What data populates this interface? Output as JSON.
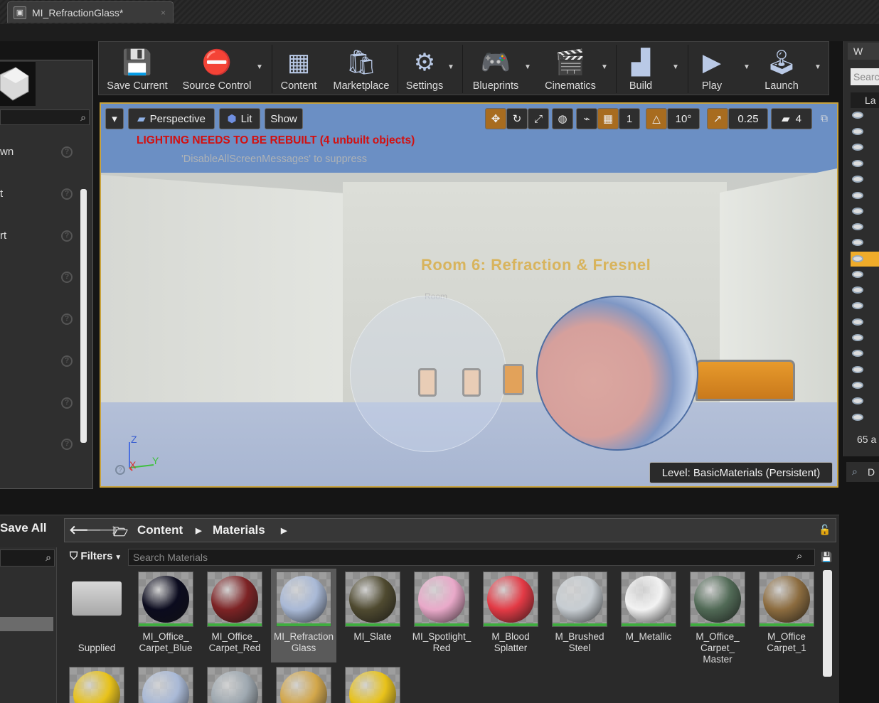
{
  "window": {
    "tab_title": "MI_RefractionGlass*",
    "close_glyph": "×"
  },
  "toolbar": {
    "save_current": "Save Current",
    "source_control": "Source Control",
    "content": "Content",
    "marketplace": "Marketplace",
    "settings": "Settings",
    "blueprints": "Blueprints",
    "cinematics": "Cinematics",
    "build": "Build",
    "play": "Play",
    "launch": "Launch"
  },
  "left_panel": {
    "items": [
      "wn",
      "t",
      "rt"
    ]
  },
  "viewport": {
    "perspective": "Perspective",
    "lit": "Lit",
    "show": "Show",
    "grid_value": "1",
    "rotation_snap": "10°",
    "scale_snap": "0.25",
    "camera_speed": "4",
    "lighting_warning": "LIGHTING NEEDS TO BE REBUILT (4 unbuilt objects)",
    "disable_message": "'DisableAllScreenMessages' to suppress",
    "room_label": "Room 6: Refraction & Fresnel",
    "room_small": "Room",
    "level": "Level:  BasicMaterials (Persistent)",
    "axis_z": "Z",
    "axis_x": "X",
    "axis_y": "Y"
  },
  "right_panel": {
    "header": "W",
    "search": "Searc",
    "column": "La",
    "count": "65 a",
    "details_tab": "D"
  },
  "content_browser": {
    "save_all": "Save All",
    "path": [
      "Content",
      "Materials"
    ],
    "filters": "Filters",
    "search_placeholder": "Search Materials",
    "assets": [
      {
        "name": "Supplied",
        "color": "#b5b5b5"
      },
      {
        "name": "MI_Office_ Carpet_Blue",
        "color": "#0b0b1e"
      },
      {
        "name": "MI_Office_ Carpet_Red",
        "color": "#7d2325"
      },
      {
        "name": "MI_Refraction Glass",
        "color": "#a9b9d6"
      },
      {
        "name": "MI_Slate",
        "color": "#4f4a30"
      },
      {
        "name": "MI_Spotlight_ Red",
        "color": "#e9a9c9"
      },
      {
        "name": "M_Blood Splatter",
        "color": "#e33a45"
      },
      {
        "name": "M_Brushed Steel",
        "color": "#c7cdd2"
      },
      {
        "name": "M_Metallic",
        "color": "#f2f2f2"
      },
      {
        "name": "M_Office_ Carpet_ Master",
        "color": "#516a56"
      },
      {
        "name": "M_Office Carpet_1",
        "color": "#8c6c3f"
      }
    ],
    "row2_colors": [
      "#e8c21a",
      "#a9b9d6",
      "#9ea8b0",
      "#d3a74a",
      "#e8c21a"
    ]
  }
}
